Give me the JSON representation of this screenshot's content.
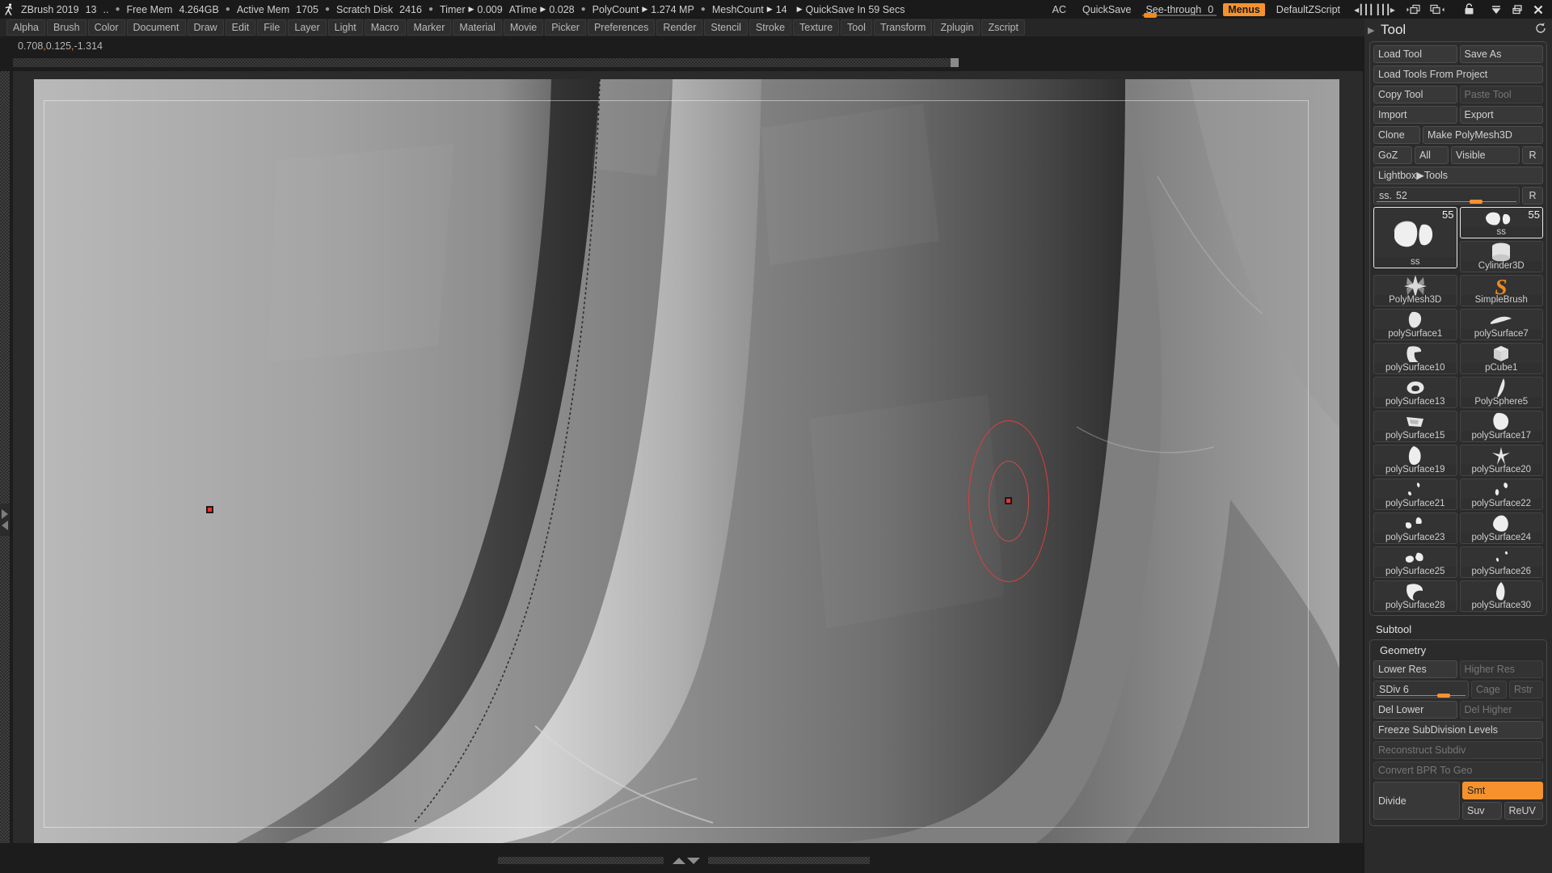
{
  "titlebar": {
    "app": "ZBrush 2019",
    "doc_num": "13",
    "dots": "..",
    "stats": [
      {
        "label": "Free Mem",
        "value": "4.264GB",
        "arrow": false
      },
      {
        "label": "Active Mem",
        "value": "1705",
        "arrow": false
      },
      {
        "label": "Scratch Disk",
        "value": "2416",
        "arrow": false
      },
      {
        "label": "Timer",
        "value": "0.009",
        "arrow": true
      },
      {
        "label": "ATime",
        "value": "0.028",
        "arrow": true
      },
      {
        "label": "PolyCount",
        "value": "1.274 MP",
        "arrow": true
      },
      {
        "label": "MeshCount",
        "value": "14",
        "arrow": true
      }
    ],
    "quicksave_status": "QuickSave In 59 Secs",
    "ac": "AC",
    "quicksave": "QuickSave",
    "seethrough_label": "See-through",
    "seethrough_value": "0",
    "menus": "Menus",
    "zscript": "DefaultZScript",
    "icons": [
      "tray-left-icon",
      "tray-right-icon",
      "doc-left-icon",
      "doc-right-icon",
      "lock-icon",
      "minimize-icon",
      "restore-icon",
      "close-icon"
    ]
  },
  "menubar": {
    "items": [
      "Alpha",
      "Brush",
      "Color",
      "Document",
      "Draw",
      "Edit",
      "File",
      "Layer",
      "Light",
      "Macro",
      "Marker",
      "Material",
      "Movie",
      "Picker",
      "Preferences",
      "Render",
      "Stencil",
      "Stroke",
      "Texture",
      "Tool",
      "Transform",
      "Zplugin",
      "Zscript"
    ]
  },
  "canvas": {
    "coordinates": "0.708,0.125,-1.314",
    "coord_parts": [
      "0.708",
      "0.125",
      "-1.314"
    ],
    "brush_cursor_name": "brush-cursor-ring",
    "marker_name": "canvas-marker"
  },
  "tool_panel": {
    "title": "Tool",
    "reset_icon": "reset-icon",
    "buttons": {
      "load_tool": "Load Tool",
      "save_as": "Save As",
      "load_tools_from_project": "Load Tools From Project",
      "copy_tool": "Copy Tool",
      "paste_tool": "Paste Tool",
      "import": "Import",
      "export": "Export",
      "clone": "Clone",
      "make_polymesh3d": "Make PolyMesh3D",
      "goz": "GoZ",
      "all": "All",
      "visible": "Visible",
      "r": "R",
      "lightbox_tools": "Lightbox▶Tools"
    },
    "ss_slider": {
      "label": "ss.",
      "value": "52",
      "r": "R"
    },
    "thumbs": [
      {
        "label": "ss",
        "num": "55",
        "icon": "ss-mesh-icon",
        "big": true,
        "selected": true
      },
      {
        "label": "ss",
        "num": "55",
        "icon": "ss-mesh-icon",
        "selected": true
      },
      {
        "label": "Cylinder3D",
        "icon": "cylinder-icon"
      },
      {
        "label": "PolyMesh3D",
        "icon": "star-icon"
      },
      {
        "label": "SimpleBrush",
        "icon": "s-logo-icon"
      },
      {
        "label": "polySurface1",
        "icon": "polysurface-icon"
      },
      {
        "label": "polySurface7",
        "icon": "polysurface-icon"
      },
      {
        "label": "polySurface10",
        "icon": "polysurface-icon"
      },
      {
        "label": "pCube1",
        "icon": "cube-icon"
      },
      {
        "label": "polySurface13",
        "icon": "polysurface-icon"
      },
      {
        "label": "PolySphere5",
        "icon": "polysurface-icon"
      },
      {
        "label": "polySurface15",
        "icon": "polysurface-icon"
      },
      {
        "label": "polySurface17",
        "icon": "polysurface-icon"
      },
      {
        "label": "polySurface19",
        "icon": "polysurface-icon"
      },
      {
        "label": "polySurface20",
        "icon": "polysurface-icon"
      },
      {
        "label": "polySurface21",
        "icon": "polysurface-icon"
      },
      {
        "label": "polySurface22",
        "icon": "polysurface-icon"
      },
      {
        "label": "polySurface23",
        "icon": "polysurface-icon"
      },
      {
        "label": "polySurface24",
        "icon": "polysurface-icon"
      },
      {
        "label": "polySurface25",
        "icon": "polysurface-icon"
      },
      {
        "label": "polySurface26",
        "icon": "polysurface-icon"
      },
      {
        "label": "polySurface28",
        "icon": "polysurface-icon"
      },
      {
        "label": "polySurface30",
        "icon": "polysurface-icon"
      }
    ],
    "subtool_label": "Subtool",
    "geometry": {
      "title": "Geometry",
      "lower_res": "Lower Res",
      "higher_res": "Higher Res",
      "sdiv": "SDiv 6",
      "cage": "Cage",
      "rstr": "Rstr",
      "del_lower": "Del Lower",
      "del_higher": "Del Higher",
      "freeze": "Freeze SubDivision Levels",
      "reconstruct": "Reconstruct Subdiv",
      "convert_bpr": "Convert BPR To Geo",
      "divide": "Divide",
      "smt": "Smt",
      "suv": "Suv",
      "reuv": "ReUV"
    }
  },
  "colors": {
    "accent": "#f5922e",
    "panel_bg": "#2b2b2b",
    "titlebar_bg": "#1a1a1a",
    "cursor_red": "#e63b3b",
    "marker_red": "#f03030"
  }
}
